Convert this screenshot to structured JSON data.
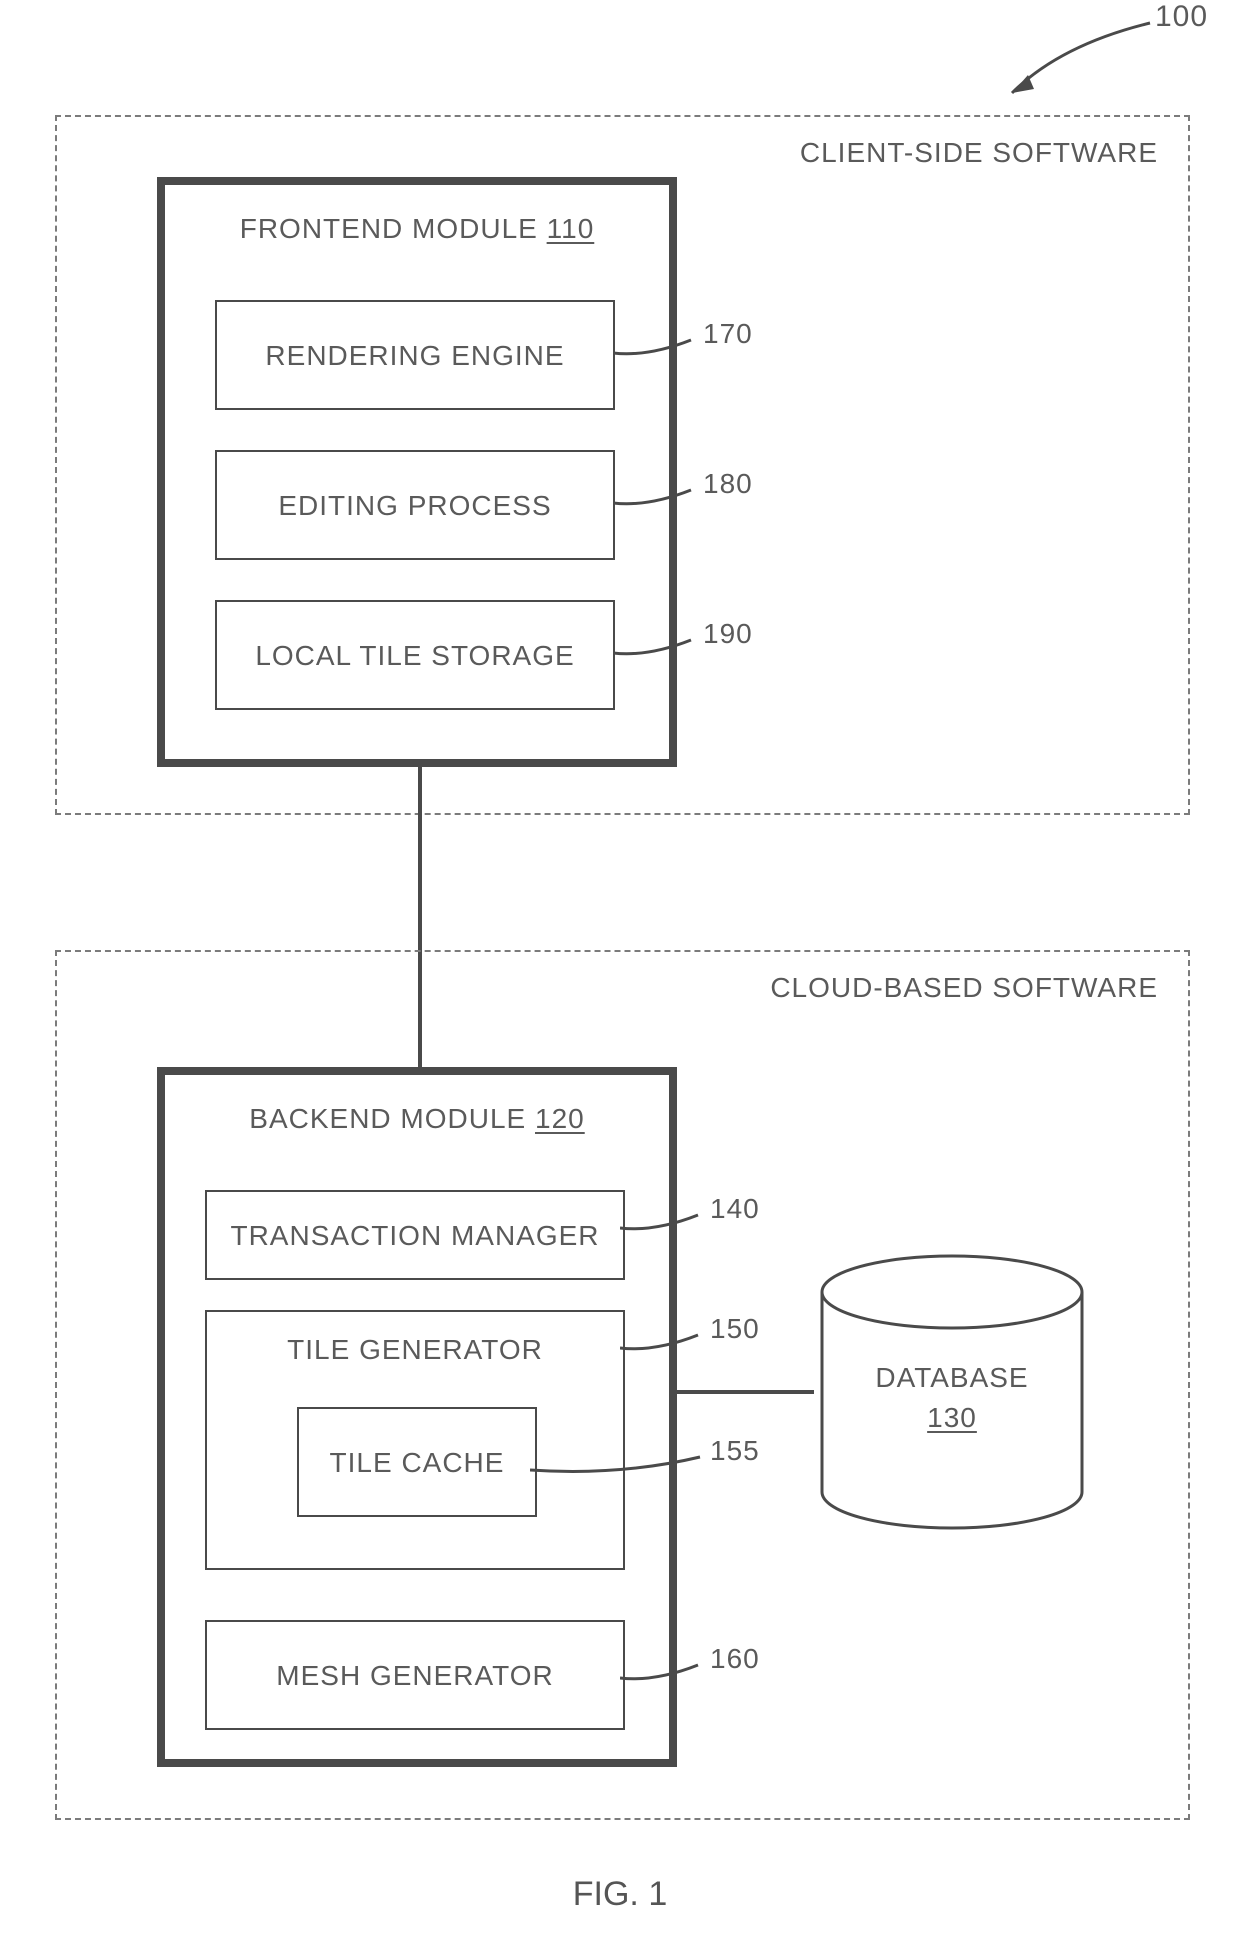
{
  "figure": {
    "system_ref": "100",
    "caption": "FIG. 1",
    "client": {
      "title": "CLIENT-SIDE SOFTWARE",
      "frontend": {
        "title": "FRONTEND MODULE",
        "ref": "110",
        "rendering": {
          "label": "RENDERING ENGINE",
          "ref": "170"
        },
        "editing": {
          "label": "EDITING PROCESS",
          "ref": "180"
        },
        "storage": {
          "label": "LOCAL TILE STORAGE",
          "ref": "190"
        }
      }
    },
    "cloud": {
      "title": "CLOUD-BASED SOFTWARE",
      "backend": {
        "title": "BACKEND MODULE",
        "ref": "120",
        "txn": {
          "label": "TRANSACTION MANAGER",
          "ref": "140"
        },
        "tile": {
          "label": "TILE GENERATOR",
          "ref": "150",
          "cache": {
            "label": "TILE CACHE",
            "ref": "155"
          }
        },
        "mesh": {
          "label": "MESH GENERATOR",
          "ref": "160"
        }
      },
      "database": {
        "label": "DATABASE",
        "ref": "130"
      }
    }
  }
}
